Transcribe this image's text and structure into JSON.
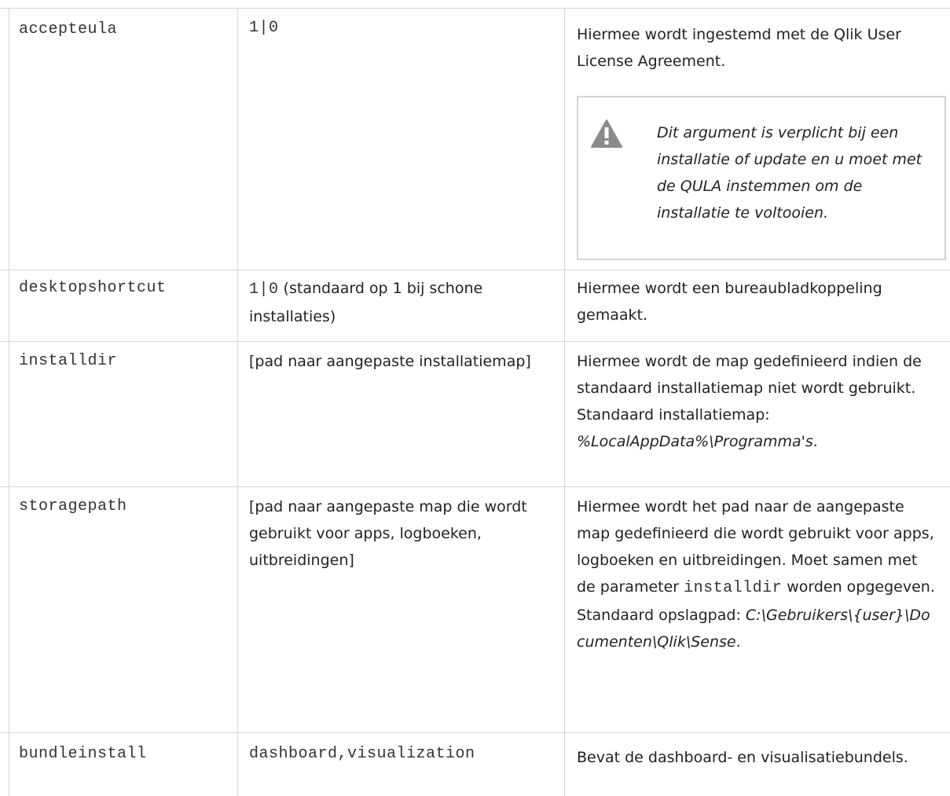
{
  "rows": [
    {
      "name": "accepteula",
      "value_code": "1|0",
      "description": "Hiermee wordt ingestemd met de Qlik User License Agreement.",
      "warning": "Dit argument is verplicht bij een installatie of update en u moet met de QULA instemmen om de installatie te voltooien."
    },
    {
      "name": "desktopshortcut",
      "value_code": "1|0",
      "value_text": " (standaard op 1 bij schone installaties)",
      "description": "Hiermee wordt een bureaubladkoppeling gemaakt."
    },
    {
      "name": "installdir",
      "value_text": "[pad naar aangepaste installatiemap]",
      "description": "Hiermee wordt de map gedefinieerd indien de standaard installatiemap niet wordt gebruikt. Standaard installatiemap: ",
      "description_italic": "%LocalAppData%\\Programma's",
      "description_end": "."
    },
    {
      "name": "storagepath",
      "value_text": "[pad naar aangepaste map die wordt gebruikt voor apps, logboeken, uitbreidingen]",
      "description": "Hiermee wordt het pad naar de aangepaste map gedefinieerd die wordt gebruikt voor apps, logboeken en uitbreidingen. Moet samen met de parameter ",
      "description_code": "installdir",
      "description_mid": " worden opgegeven. Standaard opslagpad: ",
      "description_italic": "C:\\Gebruikers\\{user}\\Documenten\\Qlik\\Sense",
      "description_end": "."
    },
    {
      "name": "bundleinstall",
      "value_code": "dashboard,visualization",
      "description": "Bevat de dashboard- en visualisatiebundels."
    }
  ],
  "icons": {
    "warning": "warning-triangle-icon"
  },
  "colors": {
    "border": "#d5d5d5",
    "warning_icon": "#8a8a8a"
  }
}
